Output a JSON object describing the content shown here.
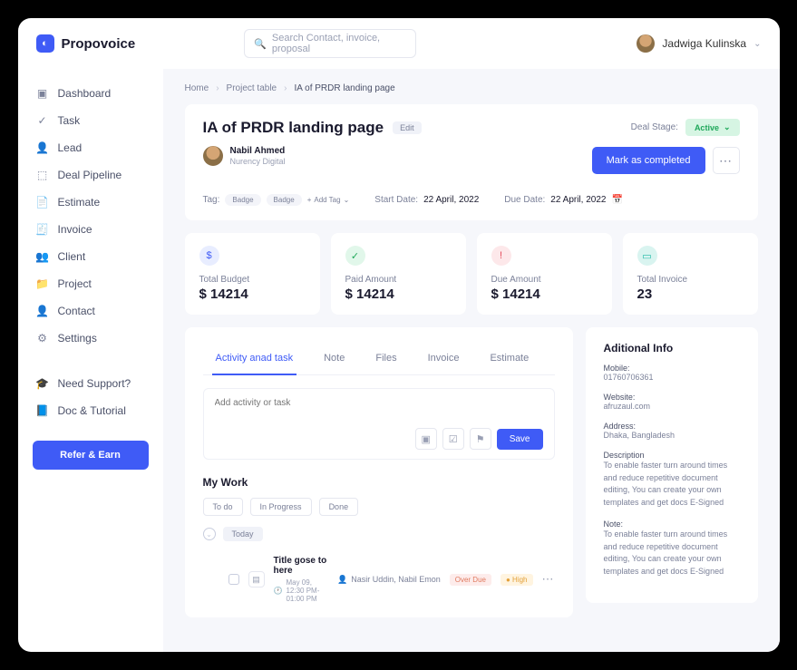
{
  "brand": "Propovoice",
  "search": {
    "placeholder": "Search Contact, invoice, proposal"
  },
  "user": {
    "name": "Jadwiga Kulinska"
  },
  "nav": {
    "items": [
      {
        "label": "Dashboard",
        "icon": "▣"
      },
      {
        "label": "Task",
        "icon": "✓"
      },
      {
        "label": "Lead",
        "icon": "👤"
      },
      {
        "label": "Deal Pipeline",
        "icon": "⬚"
      },
      {
        "label": "Estimate",
        "icon": "📄"
      },
      {
        "label": "Invoice",
        "icon": "🧾"
      },
      {
        "label": "Client",
        "icon": "👥"
      },
      {
        "label": "Project",
        "icon": "📁"
      },
      {
        "label": "Contact",
        "icon": "👤"
      },
      {
        "label": "Settings",
        "icon": "⚙"
      }
    ],
    "support": [
      {
        "label": "Need Support?",
        "icon": "🎓"
      },
      {
        "label": "Doc & Tutorial",
        "icon": "📘"
      }
    ],
    "refer": "Refer & Earn"
  },
  "breadcrumb": {
    "a": "Home",
    "b": "Project table",
    "c": "IA of PRDR landing page"
  },
  "page": {
    "title": "IA of PRDR landing page",
    "edit": "Edit",
    "authorName": "Nabil Ahmed",
    "authorOrg": "Nurency Digital",
    "dealStageLabel": "Deal Stage:",
    "dealStage": "Active",
    "completeBtn": "Mark as completed",
    "tagLabel": "Tag:",
    "tags": [
      "Badge",
      "Badge"
    ],
    "addTag": "Add Tag",
    "startLabel": "Start Date:",
    "startDate": "22 April, 2022",
    "dueLabel": "Due Date:",
    "dueDate": "22 April, 2022"
  },
  "stats": [
    {
      "label": "Total Budget",
      "value": "$ 14214"
    },
    {
      "label": "Paid Amount",
      "value": "$ 14214"
    },
    {
      "label": "Due Amount",
      "value": "$ 14214"
    },
    {
      "label": "Total Invoice",
      "value": "23"
    }
  ],
  "tabs": [
    "Activity anad task",
    "Note",
    "Files",
    "Invoice",
    "Estimate"
  ],
  "activity": {
    "placeholder": "Add activity or task",
    "save": "Save"
  },
  "mywork": {
    "heading": "My Work",
    "filters": [
      "To do",
      "In Progress",
      "Done"
    ],
    "today": "Today",
    "task": {
      "title": "Title gose to here",
      "time": "May 09, 12:30 PM-01:00 PM",
      "assign": "Nasir Uddin, Nabil Emon",
      "overdue": "Over Due",
      "priority": "High"
    }
  },
  "info": {
    "heading": "Aditional Info",
    "mobileLabel": "Mobile:",
    "mobile": "01760706361",
    "websiteLabel": "Website:",
    "website": "afruzaul.com",
    "addressLabel": "Address:",
    "address": "Dhaka, Bangladesh",
    "descLabel": "Description",
    "desc": "To enable faster turn around times and reduce repetitive document editing, You can create your own templates and get docs E-Signed",
    "noteLabel": "Note:",
    "note": "To enable faster turn around times and reduce repetitive document editing, You can create your own templates and get docs E-Signed"
  }
}
